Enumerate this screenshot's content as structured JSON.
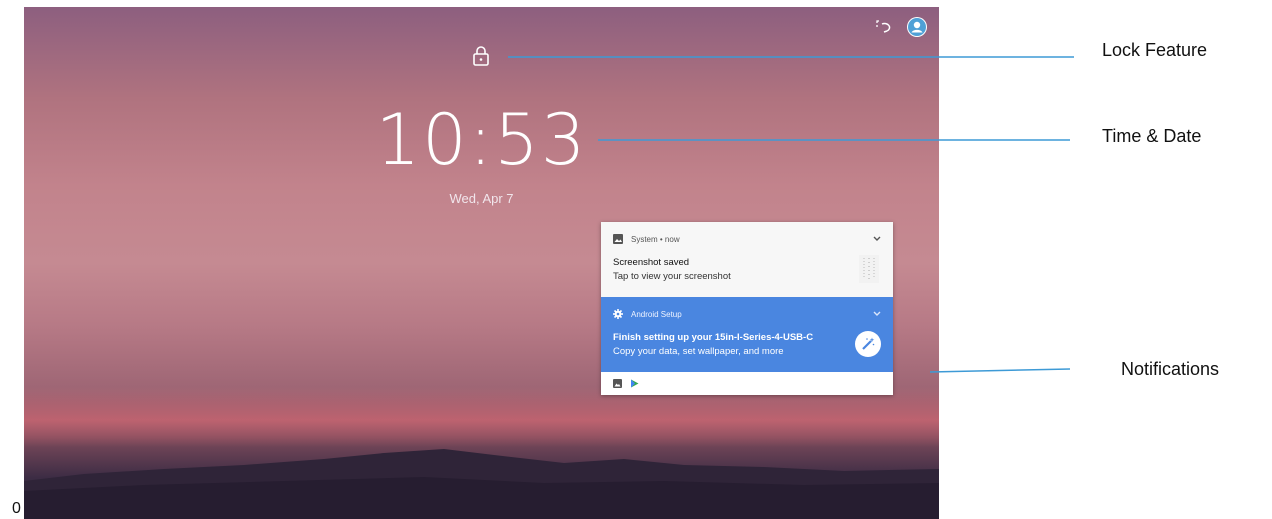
{
  "page_number": "0",
  "lockscreen": {
    "time": "10:53",
    "date": "Wed, Apr 7"
  },
  "notifications": [
    {
      "app": "System • now",
      "title": "Screenshot saved",
      "text": "Tap to view your screenshot",
      "icon": "image-icon"
    },
    {
      "app": "Android Setup",
      "title": "Finish setting up your 15in-I-Series-4-USB-C",
      "text": "Copy your data, set wallpaper, and more",
      "icon": "gear-icon",
      "action_icon": "magic-wand-icon",
      "color": "#4a86e0"
    }
  ],
  "notification_footer_icons": [
    "image-icon",
    "play-store-icon"
  ],
  "callouts": {
    "lock": "Lock Feature",
    "time": "Time & Date",
    "notifications": "Notifications"
  },
  "colors": {
    "callout_line": "#3d9ad6",
    "setup_notification": "#4a86e0"
  }
}
